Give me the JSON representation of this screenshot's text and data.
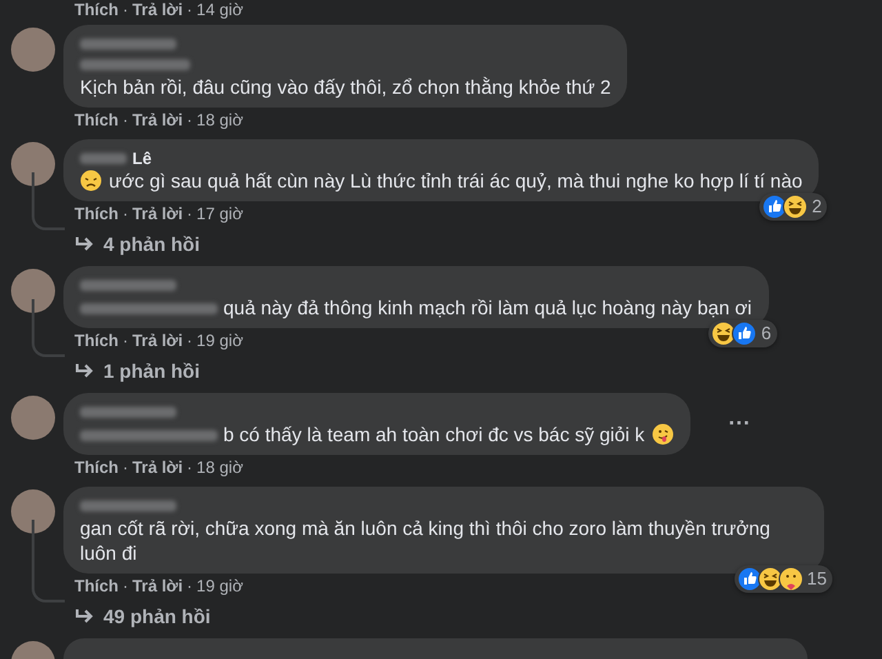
{
  "top_meta": {
    "like": "Thích",
    "separator": "·",
    "reply": "Trả lời",
    "time": "14 giờ"
  },
  "comments": [
    {
      "author_blurred": true,
      "second_line_blurred": true,
      "text": "Kịch bản rồi, đâu cũng vào đấy thôi, zổ chọn thằng khỏe thứ 2",
      "meta": {
        "like": "Thích",
        "separator": "·",
        "reply": "Trả lời",
        "time": "18 giờ"
      }
    },
    {
      "author": "Lê",
      "author_blurred": true,
      "leading_emoji": {
        "kind": "sad"
      },
      "text": "ước gì sau quả hất cùn này Lù thức tỉnh trái ác quỷ, mà thui nghe ko hợp lí tí nào",
      "meta": {
        "like": "Thích",
        "separator": "·",
        "reply": "Trả lời",
        "time": "17 giờ"
      },
      "reactions": [
        {
          "kind": "like"
        },
        {
          "kind": "haha"
        }
      ],
      "reaction_count": "2",
      "replies": "4 phản hồi"
    },
    {
      "author_blurred": true,
      "prefix_blurred": true,
      "text": "quả này đả thông kinh mạch rồi làm quả lục hoàng này bạn ơi",
      "meta": {
        "like": "Thích",
        "separator": "·",
        "reply": "Trả lời",
        "time": "19 giờ"
      },
      "reactions": [
        {
          "kind": "haha"
        },
        {
          "kind": "like"
        }
      ],
      "reaction_count": "6",
      "replies": "1 phản hồi"
    },
    {
      "author_blurred": true,
      "prefix_blurred": true,
      "text": "b có thấy là team ah toàn chơi đc vs bác sỹ giỏi k",
      "trailing_emoji": {
        "kind": "tongue"
      },
      "more": "···",
      "meta": {
        "like": "Thích",
        "separator": "·",
        "reply": "Trả lời",
        "time": "18 giờ"
      }
    },
    {
      "author_blurred": true,
      "text": "gan cốt rã rời, chữa xong mà ăn luôn cả king thì thôi cho zoro làm thuyền trưởng luôn đi",
      "meta": {
        "like": "Thích",
        "separator": "·",
        "reply": "Trả lời",
        "time": "19 giờ"
      },
      "reactions": [
        {
          "kind": "like"
        },
        {
          "kind": "haha"
        },
        {
          "kind": "care"
        }
      ],
      "reaction_count": "15",
      "replies": "49 phản hồi"
    }
  ]
}
